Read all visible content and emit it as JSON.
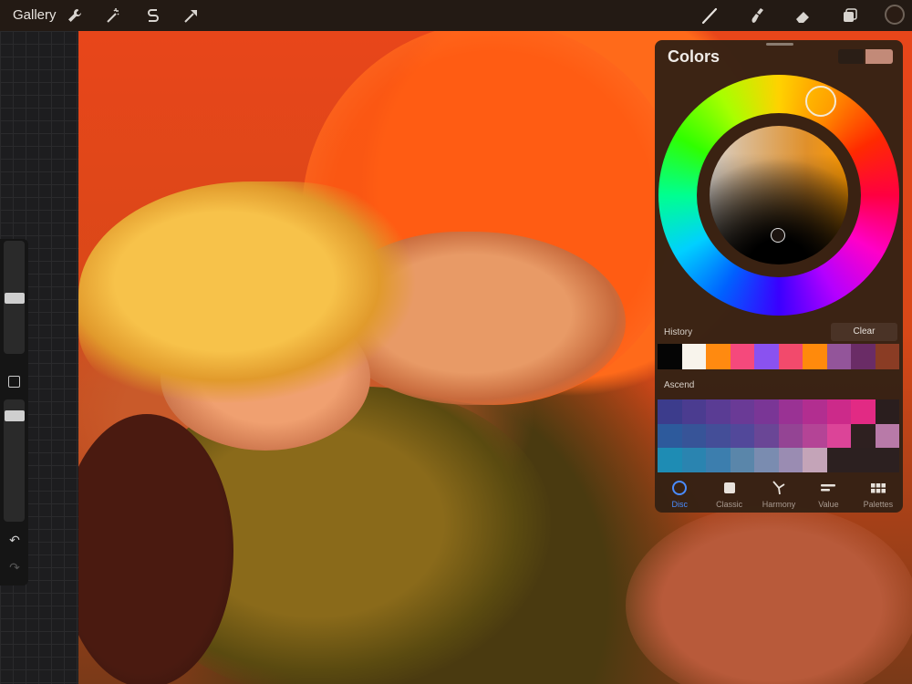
{
  "topbar": {
    "gallery_label": "Gallery",
    "left_tools": [
      "wrench-icon",
      "magic-wand-icon",
      "selection-s-icon",
      "transform-arrow-icon"
    ],
    "right_tools": [
      "brush-icon",
      "smudge-icon",
      "eraser-icon",
      "layers-icon"
    ]
  },
  "colors_panel": {
    "title": "Colors",
    "history_label": "History",
    "clear_label": "Clear",
    "palette_name": "Ascend",
    "primary_color": "#c28a78",
    "secondary_color": "#2a1e16",
    "history": [
      "#050505",
      "#f8f4ec",
      "#ff8a10",
      "#f5497c",
      "#8a52f0",
      "#f24a6c",
      "#ff8a0c",
      "#93559a",
      "#6a2c66",
      "#8a3c24"
    ],
    "palette_rows": [
      [
        "#3c3c8c",
        "#4b3c90",
        "#5a3c94",
        "#6a3a96",
        "#7a3696",
        "#9a3294",
        "#b22e90",
        "#cc2a8a",
        "#e22a84",
        "#2a1e1e"
      ],
      [
        "#2d5a9c",
        "#375498",
        "#444e98",
        "#52489a",
        "#6a4696",
        "#944494",
        "#b44496",
        "#dc4498",
        "#2e2020",
        "#b87aa8"
      ],
      [
        "#1e8cb4",
        "#2a84b0",
        "#3c7eae",
        "#5a86aa",
        "#7a8cb0",
        "#9a8cb2",
        "#c4a4b8",
        "#2c2020",
        "#2c2020",
        "#2c2020"
      ]
    ],
    "tabs": [
      {
        "label": "Disc",
        "icon": "disc-icon",
        "active": true
      },
      {
        "label": "Classic",
        "icon": "classic-square-icon",
        "active": false
      },
      {
        "label": "Harmony",
        "icon": "harmony-icon",
        "active": false
      },
      {
        "label": "Value",
        "icon": "value-sliders-icon",
        "active": false
      },
      {
        "label": "Palettes",
        "icon": "palettes-grid-icon",
        "active": false
      }
    ]
  }
}
